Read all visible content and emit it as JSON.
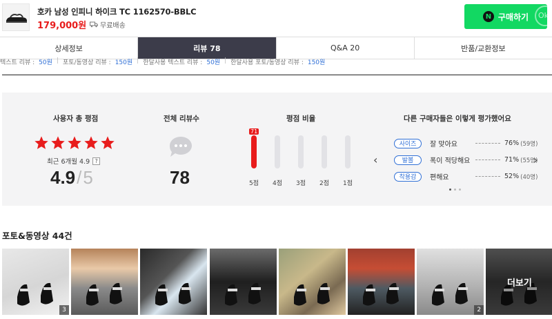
{
  "product": {
    "title": "호카 남성 인피니 하이크 TC 1162570-BBLC",
    "price": "179,000원",
    "shipping": "무료배송",
    "buy_label": "구매하기",
    "buy_badge": "N",
    "watermark": "Ok"
  },
  "tabs": [
    {
      "label": "상세정보",
      "active": false
    },
    {
      "label": "리뷰 78",
      "active": true
    },
    {
      "label": "Q&A 20",
      "active": false
    },
    {
      "label": "반품/교환정보",
      "active": false
    }
  ],
  "sub_counts": [
    {
      "label": "텍스트 리뷰 :",
      "count": "50원"
    },
    {
      "label": "포토/동영상 리뷰 :",
      "count": "150원"
    },
    {
      "label": "한달사용 텍스트 리뷰 :",
      "count": "50원"
    },
    {
      "label": "한달사용 포토/동영상 리뷰 :",
      "count": "150원"
    }
  ],
  "summary": {
    "rating_title": "사용자 총 평점",
    "recent_label": "최근 6개월 4.9",
    "help_icon": "?",
    "score": "4.9",
    "score_slash": "/",
    "score_max": "5",
    "star_count": 5,
    "star_color": "#e81c1c",
    "total_title": "전체 리뷰수",
    "total": "78",
    "ratio_title": "평점 비율",
    "ratio": [
      {
        "label": "5점",
        "percent": 71,
        "badge": "71"
      },
      {
        "label": "4점",
        "percent": 0
      },
      {
        "label": "3점",
        "percent": 0
      },
      {
        "label": "2점",
        "percent": 0
      },
      {
        "label": "1점",
        "percent": 0
      }
    ],
    "eval_title": "다른 구매자들은 이렇게 평가했어요",
    "evaluations": [
      {
        "tag": "사이즈",
        "text": "잘 맞아요",
        "pct": "76%",
        "count": "(59명)"
      },
      {
        "tag": "발볼",
        "text": "폭이 적당해요",
        "pct": "71%",
        "count": "(55명)"
      },
      {
        "tag": "착용감",
        "text": "편해요",
        "pct": "52%",
        "count": "(40명)"
      }
    ],
    "prev_arrow": "‹",
    "next_arrow": "›"
  },
  "photos": {
    "title": "포토&동영상 44건",
    "more_label": "더보기",
    "items": [
      {
        "count": "3"
      },
      {
        "count": ""
      },
      {
        "count": ""
      },
      {
        "count": ""
      },
      {
        "count": ""
      },
      {
        "count": ""
      },
      {
        "count": "2"
      },
      {
        "count": ""
      }
    ]
  },
  "colors": {
    "accent_red": "#e81c1c",
    "buy_green": "#12d862",
    "tab_active": "#3c3c4a",
    "tag_blue": "#2f6fd6"
  }
}
